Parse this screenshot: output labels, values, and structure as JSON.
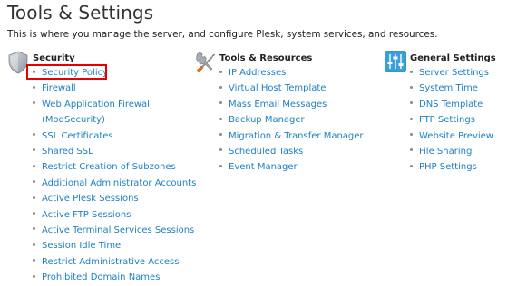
{
  "page": {
    "title": "Tools & Settings",
    "description": "This is where you manage the server, and configure Plesk, system services, and resources."
  },
  "columns": {
    "security": {
      "title": "Security",
      "icon": "shield-icon",
      "links": [
        "Security Policy",
        "Firewall",
        "Web Application Firewall",
        "(ModSecurity)",
        "SSL Certificates",
        "Shared SSL",
        "Restrict Creation of Subzones",
        "Additional Administrator Accounts",
        "Active Plesk Sessions",
        "Active FTP Sessions",
        "Active Terminal Services Sessions",
        "Session Idle Time",
        "Restrict Administrative Access",
        "Prohibited Domain Names"
      ],
      "highlighted": "Security Policy",
      "highlight_color": "#e60000"
    },
    "tools": {
      "title": "Tools & Resources",
      "icon": "wrench-screwdriver-icon",
      "links": [
        "IP Addresses",
        "Virtual Host Template",
        "Mass Email Messages",
        "Backup Manager",
        "Migration & Transfer Manager",
        "Scheduled Tasks",
        "Event Manager"
      ]
    },
    "general": {
      "title": "General Settings",
      "icon": "sliders-icon",
      "links": [
        "Server Settings",
        "System Time",
        "DNS Template",
        "FTP Settings",
        "Website Preview",
        "File Sharing",
        "PHP Settings"
      ]
    }
  },
  "colors": {
    "link": "#1f7fc1",
    "heading": "#333333"
  }
}
